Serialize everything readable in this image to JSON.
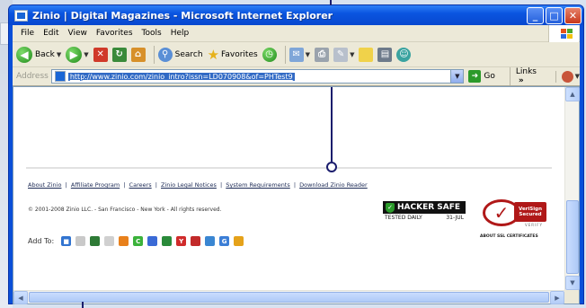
{
  "window": {
    "title": "Zinio | Digital Magazines - Microsoft Internet Explorer",
    "minimize_glyph": "_",
    "maximize_glyph": "□",
    "close_glyph": "✕"
  },
  "menu": {
    "items": [
      "File",
      "Edit",
      "View",
      "Favorites",
      "Tools",
      "Help"
    ]
  },
  "toolbar": {
    "back_label": "Back",
    "search_label": "Search",
    "favorites_label": "Favorites"
  },
  "address": {
    "label": "Address",
    "url": "http://www.zinio.com/zinio_intro?issn=LD070908&of=PHTest9",
    "go_label": "Go",
    "links_label": "Links",
    "links_chevron": "»"
  },
  "page": {
    "footer_links": [
      "About Zinio",
      "Affiliate Program",
      "Careers",
      "Zinio Legal Notices",
      "System Requirements",
      "Download Zinio Reader"
    ],
    "link_separator": "|",
    "copyright": "© 2001-2008 Zinio LLC. - San Francisco - New York - All rights reserved.",
    "hacker_safe": {
      "title": "HACKER SAFE",
      "tested": "TESTED DAILY",
      "date": "31-JUL"
    },
    "verisign": {
      "line1": "VeriSign",
      "line2": "Secured",
      "sub": "VERIFY",
      "about": "ABOUT SSL CERTIFICATES"
    },
    "add_to_label": "Add To:",
    "bookmark_icons": [
      {
        "name": "delicious-icon",
        "color": "#3274d0",
        "glyph": "■"
      },
      {
        "name": "digg-icon",
        "color": "#c9c9c9",
        "glyph": ""
      },
      {
        "name": "furl-icon",
        "color": "#2e7a36",
        "glyph": ""
      },
      {
        "name": "fark-icon",
        "color": "#d0d0d0",
        "glyph": ""
      },
      {
        "name": "blogmarks-icon",
        "color": "#e8801b",
        "glyph": ""
      },
      {
        "name": "technorati-icon",
        "color": "#3bb23b",
        "glyph": "C"
      },
      {
        "name": "google-icon",
        "color": "#3a6ad6",
        "glyph": ""
      },
      {
        "name": "stumbleupon-icon",
        "color": "#2a8a3a",
        "glyph": ""
      },
      {
        "name": "yahoo-icon",
        "color": "#d02b2b",
        "glyph": "Y"
      },
      {
        "name": "newsvine-icon",
        "color": "#c22a2a",
        "glyph": ""
      },
      {
        "name": "magnolia-icon",
        "color": "#3a86d2",
        "glyph": ""
      },
      {
        "name": "spurl-icon",
        "color": "#3b7ed6",
        "glyph": "G"
      },
      {
        "name": "reddit-icon",
        "color": "#e5a21a",
        "glyph": ""
      }
    ]
  },
  "colors": {
    "xp_blue": "#0a4fd8",
    "chrome": "#ece9d8",
    "selection": "#316ac5",
    "callout": "#1b1d6d"
  }
}
